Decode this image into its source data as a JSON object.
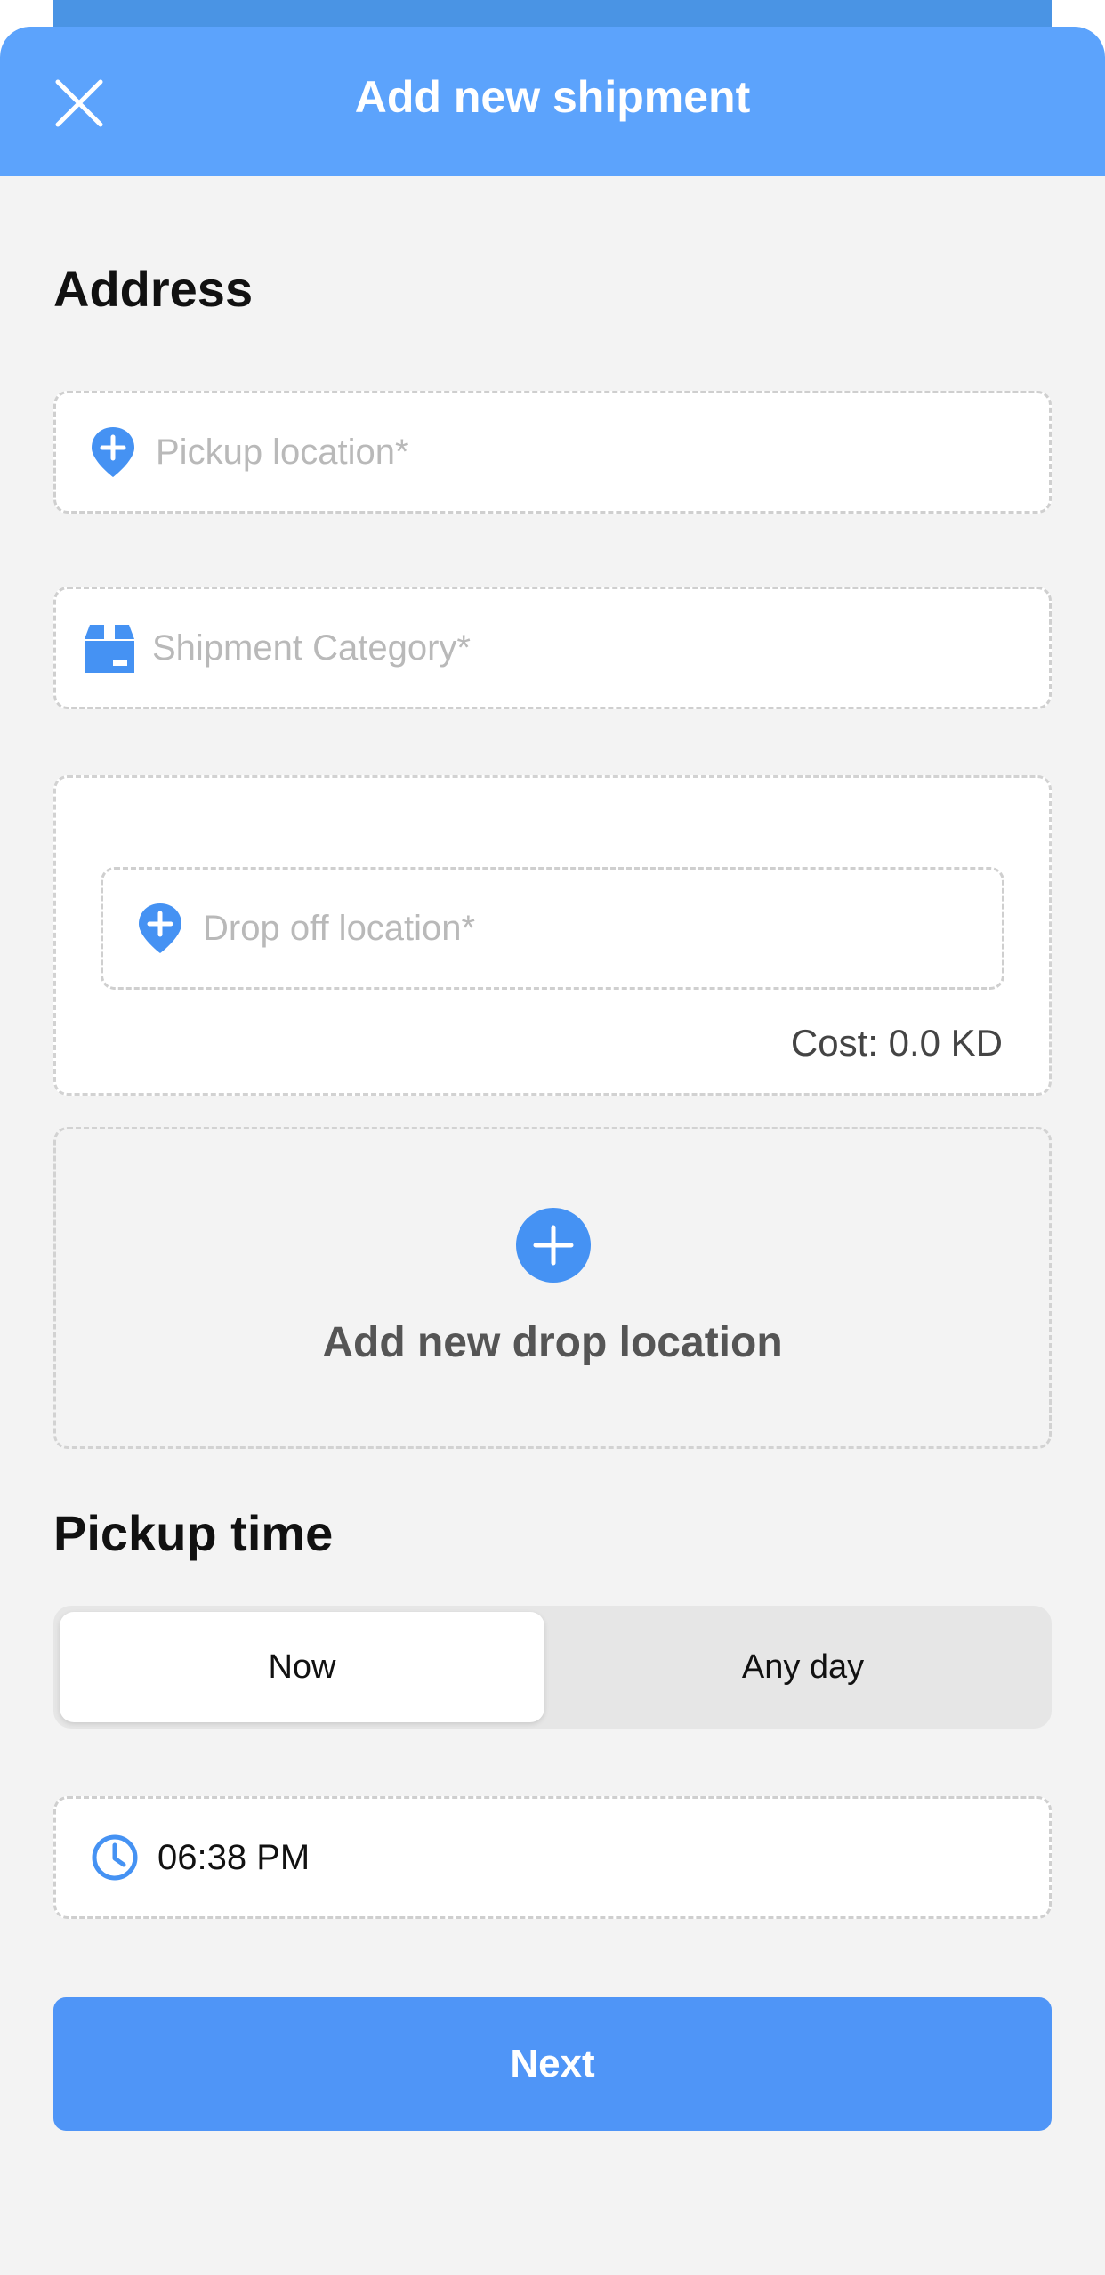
{
  "header": {
    "title": "Add new shipment",
    "close_icon": "close-icon"
  },
  "address": {
    "title": "Address",
    "pickup": {
      "placeholder": "Pickup location*",
      "icon": "location-pin-plus-icon"
    },
    "category": {
      "placeholder": "Shipment Category*",
      "icon": "box-icon"
    },
    "dropoff": {
      "placeholder": "Drop off location*",
      "icon": "location-pin-plus-icon",
      "cost": "Cost: 0.0 KD"
    },
    "add_drop": {
      "label": "Add new drop location",
      "icon": "plus-circle-icon"
    }
  },
  "pickup_time": {
    "title": "Pickup time",
    "options": [
      "Now",
      "Any day"
    ],
    "selected": "Now",
    "time_value": "06:38 PM",
    "time_icon": "clock-icon"
  },
  "actions": {
    "next_label": "Next"
  },
  "colors": {
    "accent": "#5ca3fc",
    "button": "#4f95f7",
    "icon": "#4592f3"
  }
}
